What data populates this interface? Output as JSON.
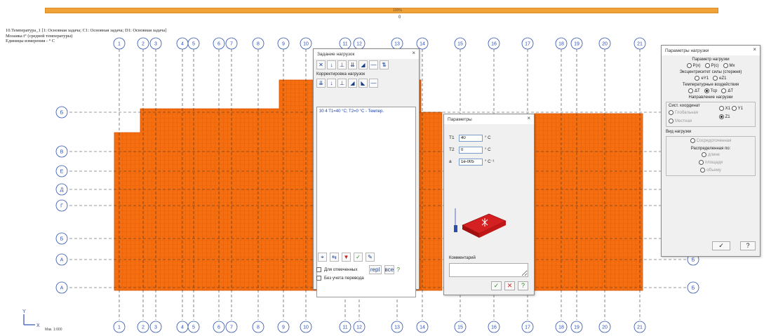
{
  "top_bar": {
    "value": "100%",
    "sub_value": "0"
  },
  "info": {
    "line1": "10.Температура_1 [1: Основная задача; C1: Основная задача; D1: Основная задача]",
    "line2": "Мозаика t° (средней температуры)",
    "line3": "Единицы измерения - ° C"
  },
  "axes": {
    "numbers": [
      "1",
      "2",
      "3",
      "4",
      "5",
      "6",
      "7",
      "8",
      "9",
      "10",
      "11",
      "12",
      "13",
      "14",
      "15",
      "16",
      "17",
      "18",
      "19",
      "20",
      "21"
    ],
    "letters_left": [
      "Б",
      "В",
      "Е",
      "Д",
      "Г",
      "Б",
      "А",
      "А"
    ],
    "letters_right": [
      "Б",
      "Б"
    ]
  },
  "scale_text": "Мак. 1:000",
  "loads_window": {
    "title": "Задание нагрузок",
    "correction_label": "Корректировка нагрузок",
    "list_item": "30 4  T1=40 °C; T2=0 °C - Темпер.",
    "check1": "Для отмеченных",
    "check2": "Без учета перевода",
    "btn_rep": "repl",
    "btn_all": "все"
  },
  "params_window": {
    "title": "Параметры",
    "t1_label": "T1",
    "t1_value": "40",
    "t1_unit": "° C",
    "t2_label": "T2",
    "t2_value": "0",
    "t2_unit": "° C",
    "a_label": "a",
    "a_value": "1e-005",
    "a_unit": "° C⁻¹",
    "comment_label": "Комментарий"
  },
  "load_panel": {
    "title": "Параметры нагрузки",
    "sec1": "Параметр нагрузки",
    "sec1_opts": [
      "Р(х)",
      "Р(с)",
      "Мх"
    ],
    "sec2": "Эксцентриситет силы (стержня)",
    "sec2_opts": [
      "еY1",
      "еZ1"
    ],
    "sec3": "Температурные воздействия",
    "sec3_opts": [
      "ΔТ",
      "Тср",
      "ΔT"
    ],
    "sec4": "Направление нагрузки",
    "sys_label": "Сист. координат",
    "sys_opts": [
      "Глобальная",
      "Местная"
    ],
    "dir_opts": [
      "X1",
      "Y1",
      "Z1"
    ],
    "sec5": "Вид нагрузки",
    "kind1": "Сосредоточенная",
    "kind2": "Распределенная по:",
    "kind_opts": [
      "длине",
      "площади",
      "объему"
    ]
  },
  "colors": {
    "mosaic": "#f56e10",
    "accent_bar": "#f0a23a",
    "axis": "#2b4fb0"
  }
}
